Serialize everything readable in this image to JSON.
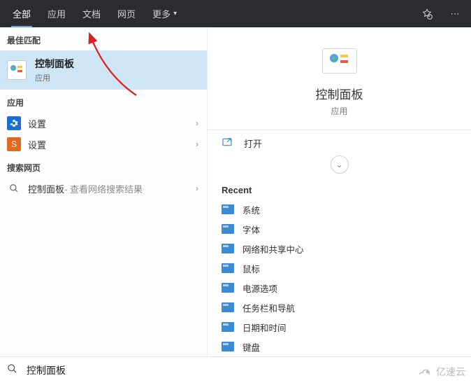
{
  "topbar": {
    "tabs": {
      "all": "全部",
      "apps": "应用",
      "docs": "文档",
      "web": "网页",
      "more": "更多"
    }
  },
  "left": {
    "best_match_header": "最佳匹配",
    "best_match": {
      "title": "控制面板",
      "subtitle": "应用"
    },
    "apps_header": "应用",
    "app_items": [
      {
        "label": "设置"
      },
      {
        "label": "设置"
      }
    ],
    "web_header": "搜索网页",
    "web_item": {
      "label": "控制面板",
      "suffix": " - 查看网络搜索结果"
    }
  },
  "right": {
    "preview": {
      "title": "控制面板",
      "subtitle": "应用"
    },
    "open_label": "打开",
    "recent_header": "Recent",
    "recent": [
      {
        "label": "系统"
      },
      {
        "label": "字体"
      },
      {
        "label": "网络和共享中心"
      },
      {
        "label": "鼠标"
      },
      {
        "label": "电源选项"
      },
      {
        "label": "任务栏和导航"
      },
      {
        "label": "日期和时间"
      },
      {
        "label": "键盘"
      }
    ]
  },
  "search": {
    "value": "控制面板"
  },
  "watermark": "亿速云",
  "colors": {
    "highlight": "#cfe6f7",
    "accent": "#3a8bd4",
    "topbar": "#2b2c2f"
  }
}
